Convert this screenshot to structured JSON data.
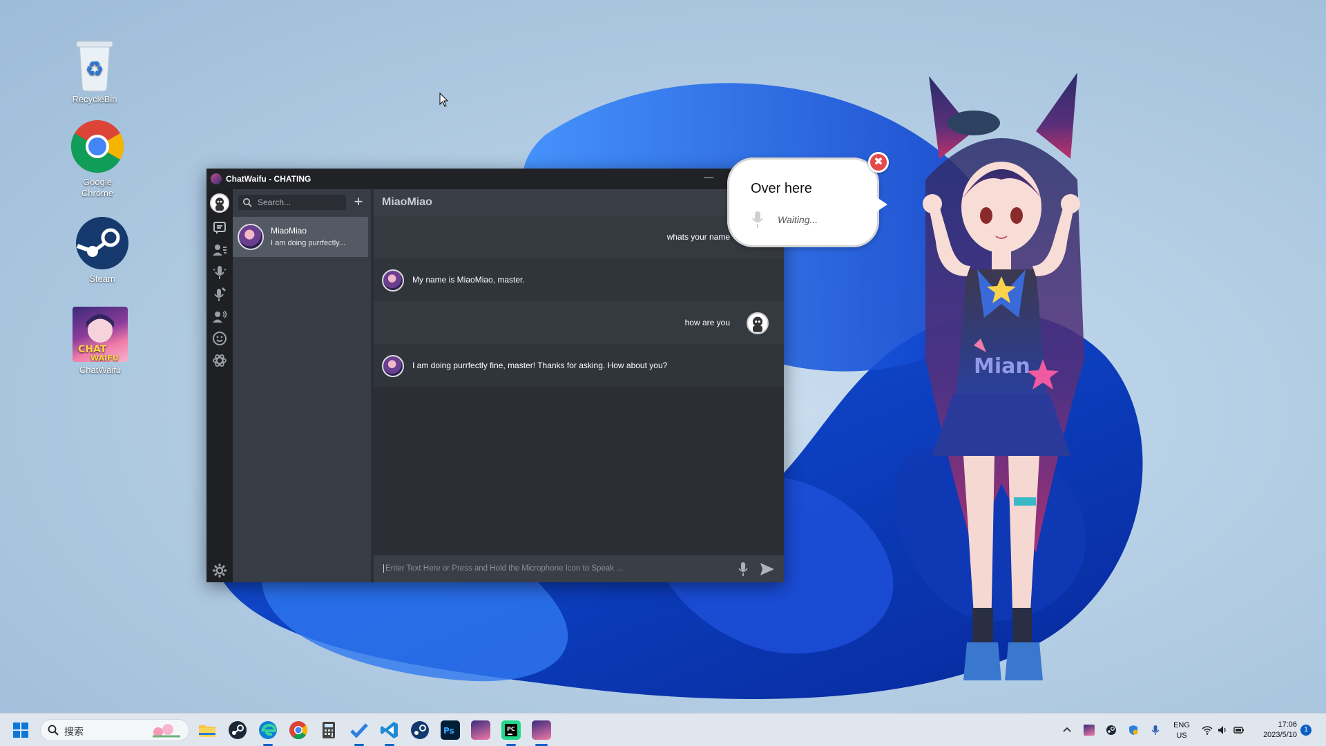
{
  "desktop": {
    "icons": [
      {
        "label": "RecycleBin"
      },
      {
        "label": "Google Chrome"
      },
      {
        "label": "Steam"
      },
      {
        "label": "ChatWaifu"
      }
    ]
  },
  "window": {
    "title": "ChatWaifu - CHATING",
    "minimize_label": "—"
  },
  "sidebar": {
    "search_placeholder": "Search...",
    "add_label": "+",
    "contacts": [
      {
        "name": "MiaoMiao",
        "preview": "I am doing purrfectly..."
      }
    ]
  },
  "chat": {
    "header": "MiaoMiao",
    "messages": [
      {
        "role": "user",
        "text": "whats your name"
      },
      {
        "role": "bot",
        "text": "My name is MiaoMiao, master."
      },
      {
        "role": "user",
        "text": "how are you"
      },
      {
        "role": "bot",
        "text": "I am doing purrfectly fine, master! Thanks for asking. How about you?"
      }
    ],
    "input_placeholder": "Enter Text Here or Press and Hold the Microphone Icon to Speak ..."
  },
  "bubble": {
    "heading": "Over here",
    "status": "Waiting...",
    "close_label": "✖"
  },
  "taskbar": {
    "search_label": "搜索",
    "lang_top": "ENG",
    "lang_bottom": "US",
    "time": "17:06",
    "date": "2023/5/10",
    "notification_count": "1"
  },
  "colors": {
    "window_bg": "#2b2e35",
    "titlebar_bg": "#202225",
    "contact_selected": "#545a64",
    "accent_blue": "#0a64c8",
    "close_red": "#e34a4a"
  }
}
